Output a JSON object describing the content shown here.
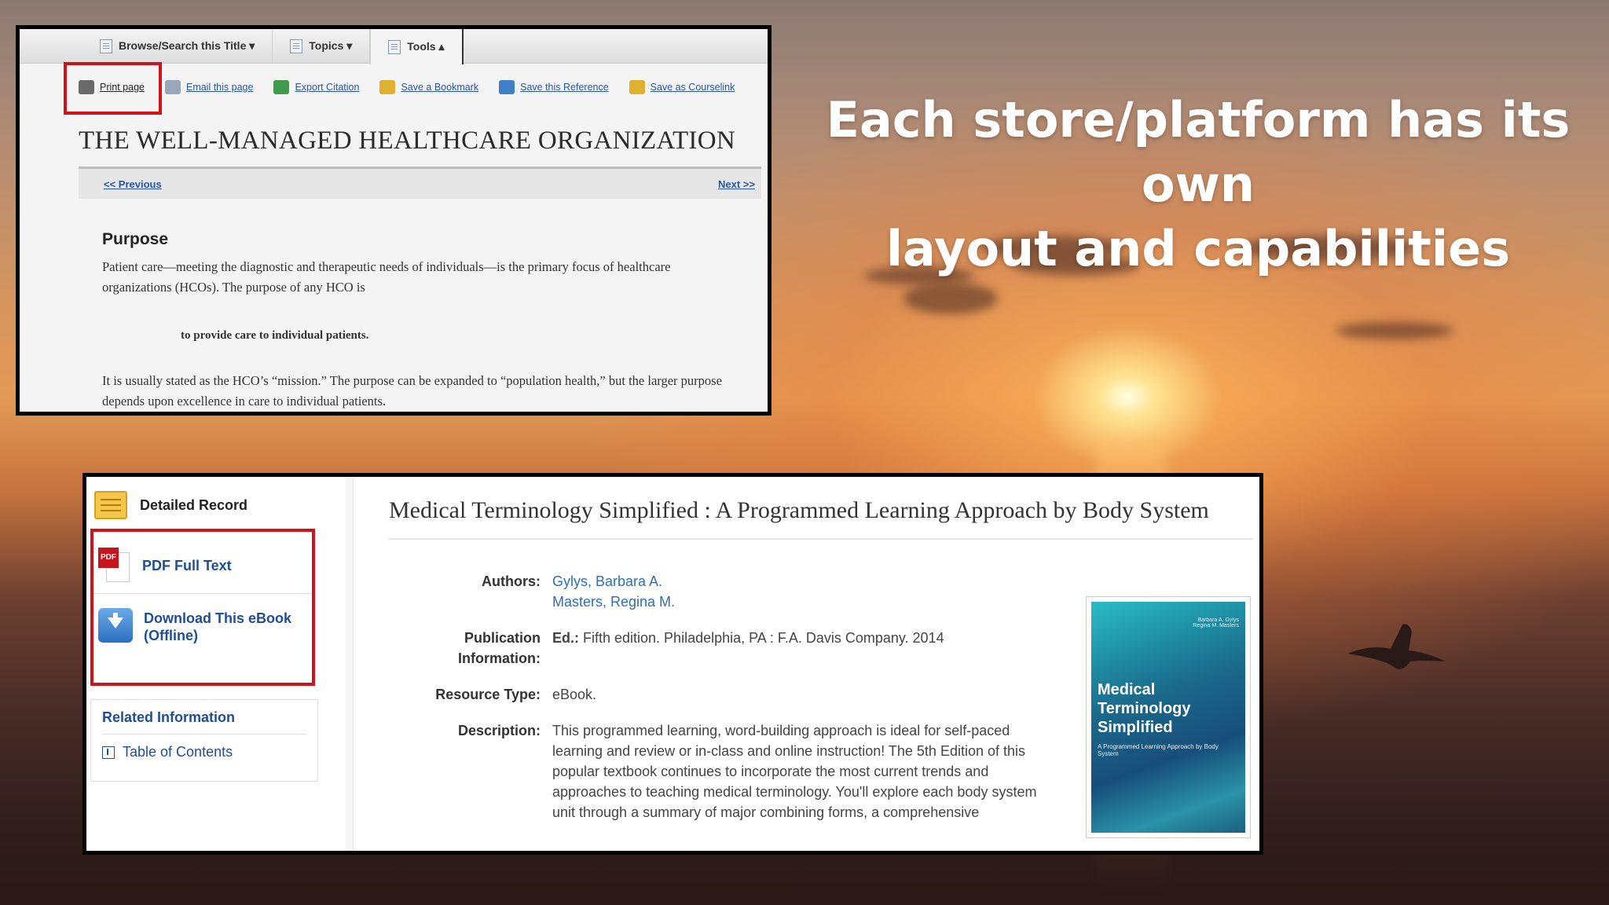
{
  "headline": {
    "line1": "Each store/platform has its own",
    "line2": "layout and capabilities"
  },
  "shot1": {
    "tabs": [
      {
        "label": "Browse/Search this Title ▾",
        "icon": "document-icon"
      },
      {
        "label": "Topics ▾",
        "icon": "list-icon"
      },
      {
        "label": "Tools ▴",
        "icon": "tools-icon"
      }
    ],
    "toolbar": [
      {
        "label": "Print page",
        "icon": "printer-icon",
        "color": "#6a6a6a"
      },
      {
        "label": "Email this page",
        "icon": "envelope-icon",
        "color": "#9aa7b8"
      },
      {
        "label": "Export Citation",
        "icon": "export-icon",
        "color": "#3f9a4b"
      },
      {
        "label": "Save a Bookmark",
        "icon": "bookmark-icon",
        "color": "#e0b030"
      },
      {
        "label": "Save this Reference",
        "icon": "save-icon",
        "color": "#3f7fc7"
      },
      {
        "label": "Save as Courselink",
        "icon": "courselink-icon",
        "color": "#e0b030"
      }
    ],
    "title": "THE WELL-MANAGED HEALTHCARE ORGANIZATION",
    "nav": {
      "prev": "<< Previous",
      "next": "Next >>"
    },
    "heading": "Purpose",
    "para1": "Patient care—meeting the diagnostic and therapeutic needs of individuals—is the primary focus of healthcare organizations (HCOs). The purpose of any HCO is",
    "quote": "to provide care to individual patients.",
    "para2": "It is usually stated as the HCO’s “mission.” The purpose can be expanded to “population health,” but the larger purpose depends upon excellence in care to individual patients."
  },
  "shot2": {
    "sidebar": {
      "record": "Detailed Record",
      "pdf_tag": "PDF",
      "pdf": "PDF Full Text",
      "download": "Download This eBook (Offline)",
      "related_title": "Related Information",
      "toc": "Table of Contents"
    },
    "title": "Medical Terminology Simplified : A Programmed Learning Approach by Body System",
    "fields": {
      "authors_label": "Authors:",
      "author1": "Gylys, Barbara A.",
      "author2": "Masters, Regina M.",
      "pub_label": "Publication Information:",
      "pub_ed": "Ed.:",
      "pub_value": " Fifth edition. Philadelphia, PA : F.A. Davis Company. 2014",
      "type_label": "Resource Type:",
      "type_value": "eBook.",
      "desc_label": "Description:",
      "desc_value": "This programmed learning, word-building approach is ideal for self-paced learning and review or in-class and online instruction! The 5th Edition of this popular textbook continues to incorporate the most current trends and approaches to teaching medical terminology. You'll explore each body system unit through a summary of major combining forms, a comprehensive"
    },
    "cover": {
      "authors": "Barbara A. Gylys\nRegina M. Masters",
      "title": "Medical Terminology Simplified",
      "subtitle": "A Programmed Learning Approach by Body System"
    }
  }
}
